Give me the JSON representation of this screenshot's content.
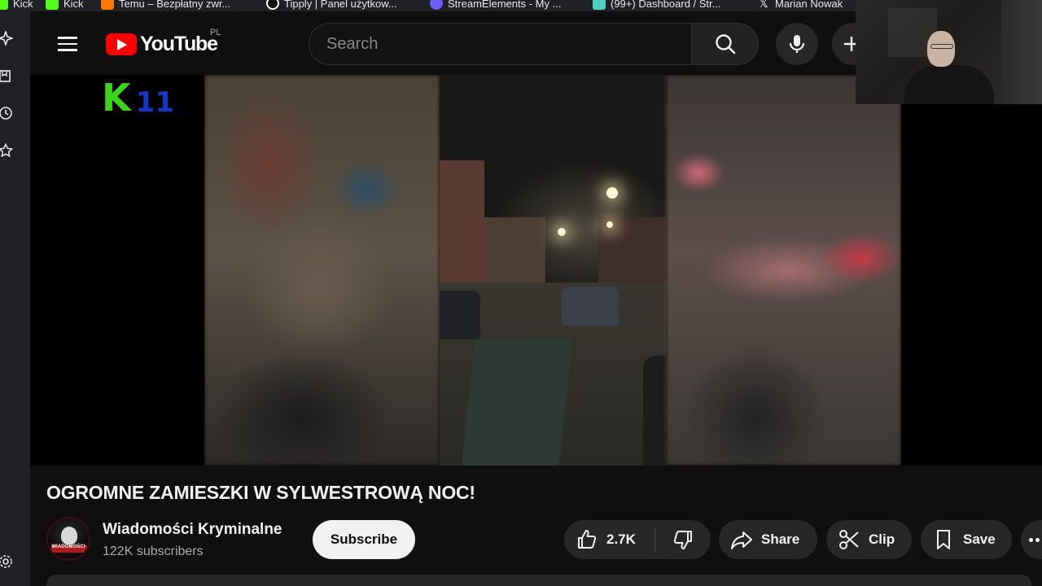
{
  "bookmarks": [
    {
      "label": "Kick",
      "color": "#53fc18"
    },
    {
      "label": "Kick",
      "color": "#53fc18"
    },
    {
      "label": "Temu – Bezpłatny zwr...",
      "color": "#fb7701"
    },
    {
      "label": "Tipply | Panel użytkow...",
      "color": "#ffffff"
    },
    {
      "label": "StreamElements - My ...",
      "color": "#6b5cff"
    },
    {
      "label": "(99+) Dashboard / Str...",
      "color": "#4fd1c5"
    },
    {
      "label": "Marian Nowak",
      "color": "#ffffff"
    }
  ],
  "sidebar": {
    "icons": [
      "ai-sparkle-icon",
      "bookmark-manager-icon",
      "history-icon",
      "favorites-icon",
      "settings-icon"
    ]
  },
  "masthead": {
    "logo_text": "YouTube",
    "country_code": "PL",
    "search_placeholder": "Search",
    "brand_color": "#ff0000"
  },
  "player": {
    "overlay_logo_letter": "K",
    "overlay_logo_number": "11"
  },
  "video": {
    "title": "OGROMNE ZAMIESZKI W SYLWESTROWĄ NOC!",
    "channel_name": "Wiadomości Kryminalne",
    "subscribers": "122K subscribers",
    "avatar_text": "WIADOMOŚCI",
    "subscribe_label": "Subscribe",
    "likes": "2.7K",
    "share_label": "Share",
    "clip_label": "Clip",
    "save_label": "Save"
  }
}
